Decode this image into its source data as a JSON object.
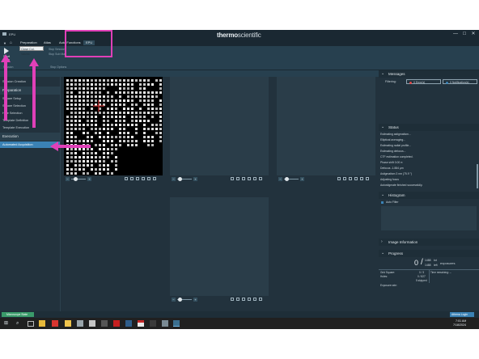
{
  "app": {
    "title": "EPU",
    "brand_bold": "thermo",
    "brand_light": "scientific",
    "window_buttons": [
      "—",
      "☐",
      "✕"
    ]
  },
  "menu": {
    "tabs": [
      "Preparation",
      "Atlas",
      "Auto Functions",
      "EPU"
    ],
    "tooltip": "Close Col. Valves"
  },
  "toolbar": {
    "start_label": "Start",
    "run_label": "Run",
    "tree_label": "Session",
    "stop_labels": [
      "Stop Session",
      "Stop Sub Ma"
    ],
    "session_label": "Session",
    "stop_options": "Stop Options"
  },
  "left_panel": {
    "items": [
      {
        "label": "Session Creation",
        "selected": false
      },
      {
        "label": "Square Setup",
        "selected": false
      },
      {
        "label": "Square Selection",
        "selected": false
      },
      {
        "label": "Hole Selection",
        "selected": false
      },
      {
        "label": "Template Definition",
        "selected": false
      },
      {
        "label": "Template Execution",
        "selected": false
      },
      {
        "label": "Automated Acquisition",
        "selected": true
      }
    ],
    "headers": {
      "preparation": "Preparation",
      "execution": "Execution"
    }
  },
  "messages": {
    "title": "Messages",
    "filtering": "Filtering:",
    "errors": "0 Error(s)",
    "notifications": "0 Notification(s)"
  },
  "status": {
    "title": "Status",
    "lines": [
      "Estimating astigmatism...",
      "Elliptical averaging...",
      "Estimating radial profile...",
      "Estimating defocus...",
      "CTF estimation completed.",
      "Phase shift 0.00 π",
      "Defocus -1.884 μm",
      "Astigmatism 3 nm (75.9 °)",
      "Adjusting focus",
      "Autostigmate finished successfully."
    ]
  },
  "histogram": {
    "title": "Histogram",
    "auto_filter": "Auto Filter"
  },
  "image_information": {
    "title": "Image Information"
  },
  "progress": {
    "title": "Progress",
    "done": "0",
    "total": "1488",
    "total_label": "tot",
    "left": "1488",
    "left_label": "left",
    "unit": "exposures",
    "grid_square_label": "Grid Square:",
    "grid_square_value": "0 / 3",
    "holes_label": "Holes:",
    "holes_value": "0 / 827",
    "skipped": "5 skipped",
    "time_remaining": "Time remaining: --",
    "exposure_rate": "Exposure rate:"
  },
  "statusbar": {
    "microscope_state": "Microscope State",
    "login": "Athena Login"
  },
  "taskbar": {
    "time": "7:01 AM",
    "date": "7/18/2024"
  },
  "colors": {
    "accent": "#3b82b5",
    "annotation": "#e040b8",
    "panel": "#22323d",
    "tile": "#2a3d49"
  }
}
